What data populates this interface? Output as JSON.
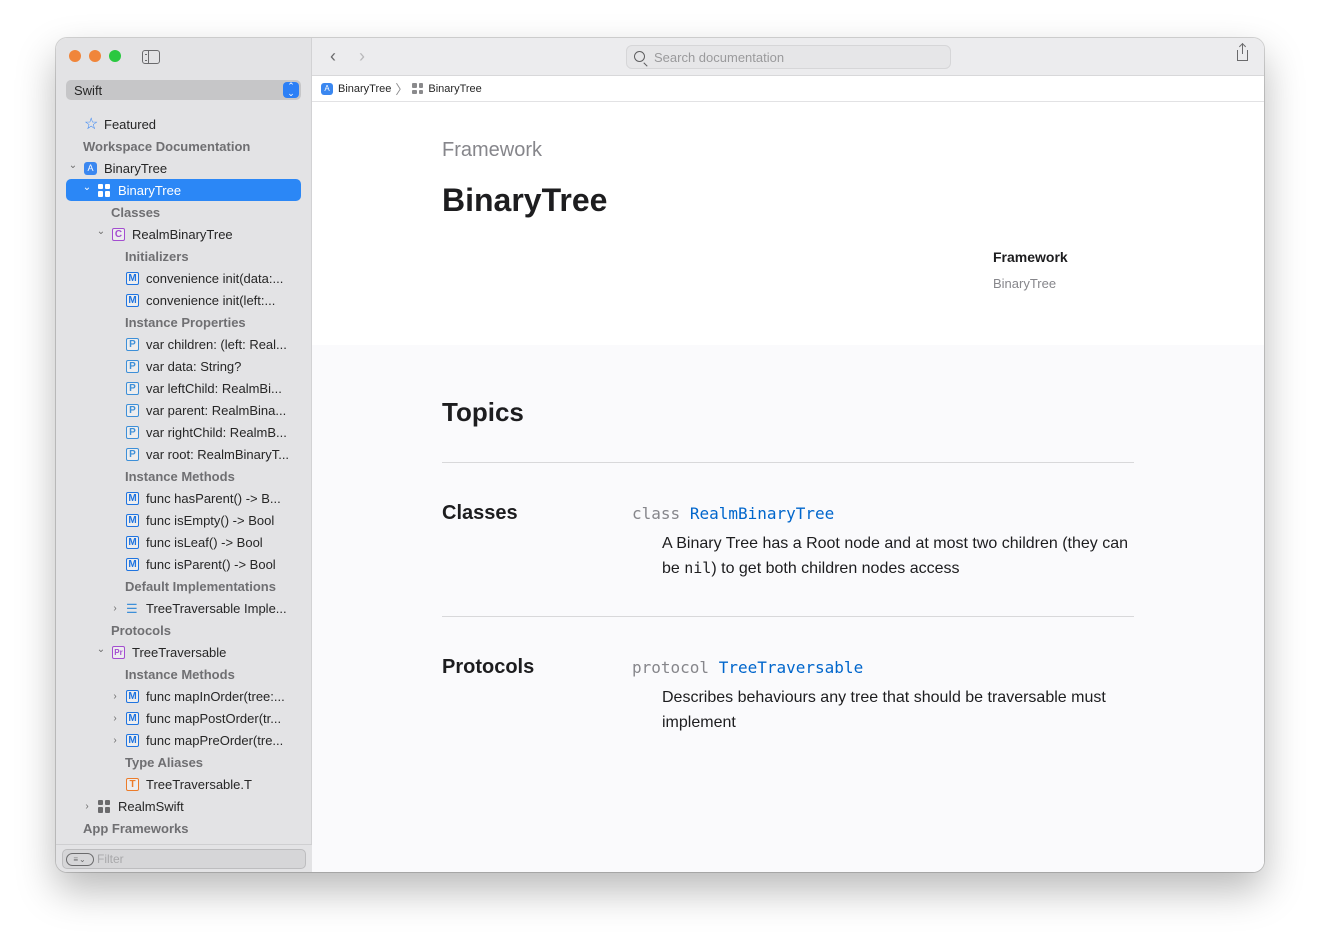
{
  "window": {
    "traffic_lights": [
      "close",
      "minimize",
      "zoom"
    ]
  },
  "sidebar": {
    "language_select": {
      "value": "Swift",
      "icon": "up-down-chevron-icon"
    },
    "tree": [
      {
        "type": "item",
        "label": "Featured",
        "icon": "star-icon",
        "level": 0
      },
      {
        "type": "header",
        "label": "Workspace Documentation",
        "level": 0
      },
      {
        "type": "item",
        "label": "BinaryTree",
        "icon": "app-icon",
        "level": 0,
        "disclosure": "expanded"
      },
      {
        "type": "item",
        "label": "BinaryTree",
        "icon": "framework-icon",
        "level": 1,
        "disclosure": "expanded",
        "selected": true
      },
      {
        "type": "header",
        "label": "Classes",
        "level": 2
      },
      {
        "type": "item",
        "label": "RealmBinaryTree",
        "icon": "class-icon",
        "glyph": "C",
        "level": 2,
        "disclosure": "expanded"
      },
      {
        "type": "header",
        "label": "Initializers",
        "level": 3
      },
      {
        "type": "item",
        "label": "convenience init(data:...",
        "icon": "method-icon",
        "glyph": "M",
        "level": 3
      },
      {
        "type": "item",
        "label": "convenience init(left:...",
        "icon": "method-icon",
        "glyph": "M",
        "level": 3
      },
      {
        "type": "header",
        "label": "Instance Properties",
        "level": 3
      },
      {
        "type": "item",
        "label": "var children: (left: Real...",
        "icon": "property-icon",
        "glyph": "P",
        "level": 3
      },
      {
        "type": "item",
        "label": "var data: String?",
        "icon": "property-icon",
        "glyph": "P",
        "level": 3
      },
      {
        "type": "item",
        "label": "var leftChild: RealmBi...",
        "icon": "property-icon",
        "glyph": "P",
        "level": 3
      },
      {
        "type": "item",
        "label": "var parent: RealmBina...",
        "icon": "property-icon",
        "glyph": "P",
        "level": 3
      },
      {
        "type": "item",
        "label": "var rightChild: RealmB...",
        "icon": "property-icon",
        "glyph": "P",
        "level": 3
      },
      {
        "type": "item",
        "label": "var root: RealmBinaryT...",
        "icon": "property-icon",
        "glyph": "P",
        "level": 3
      },
      {
        "type": "header",
        "label": "Instance Methods",
        "level": 3
      },
      {
        "type": "item",
        "label": "func hasParent() -> B...",
        "icon": "method-icon",
        "glyph": "M",
        "level": 3
      },
      {
        "type": "item",
        "label": "func isEmpty() -> Bool",
        "icon": "method-icon",
        "glyph": "M",
        "level": 3
      },
      {
        "type": "item",
        "label": "func isLeaf() -> Bool",
        "icon": "method-icon",
        "glyph": "M",
        "level": 3
      },
      {
        "type": "item",
        "label": "func isParent() -> Bool",
        "icon": "method-icon",
        "glyph": "M",
        "level": 3
      },
      {
        "type": "header",
        "label": "Default Implementations",
        "level": 3
      },
      {
        "type": "item",
        "label": "TreeTraversable Imple...",
        "icon": "list-icon",
        "level": 3,
        "disclosure": "collapsed"
      },
      {
        "type": "header",
        "label": "Protocols",
        "level": 2
      },
      {
        "type": "item",
        "label": "TreeTraversable",
        "icon": "protocol-icon",
        "glyph": "Pr",
        "level": 2,
        "disclosure": "expanded"
      },
      {
        "type": "header",
        "label": "Instance Methods",
        "level": 3
      },
      {
        "type": "item",
        "label": "func mapInOrder(tree:...",
        "icon": "method-icon",
        "glyph": "M",
        "level": 3,
        "disclosure": "collapsed"
      },
      {
        "type": "item",
        "label": "func mapPostOrder(tr...",
        "icon": "method-icon",
        "glyph": "M",
        "level": 3,
        "disclosure": "collapsed"
      },
      {
        "type": "item",
        "label": "func mapPreOrder(tre...",
        "icon": "method-icon",
        "glyph": "M",
        "level": 3,
        "disclosure": "collapsed"
      },
      {
        "type": "header",
        "label": "Type Aliases",
        "level": 3
      },
      {
        "type": "item",
        "label": "TreeTraversable.T",
        "icon": "typealias-icon",
        "glyph": "T",
        "level": 3
      },
      {
        "type": "item",
        "label": "RealmSwift",
        "icon": "framework-icon",
        "level": 1,
        "disclosure": "collapsed"
      },
      {
        "type": "header",
        "label": "App Frameworks",
        "level": 0
      }
    ],
    "filter": {
      "placeholder": "Filter",
      "icon": "filter-options-icon"
    }
  },
  "toolbar": {
    "back_icon": "chevron-left-icon",
    "forward_icon": "chevron-right-icon",
    "search": {
      "placeholder": "Search documentation",
      "value": ""
    },
    "share_icon": "share-icon"
  },
  "breadcrumb": {
    "items": [
      {
        "label": "BinaryTree",
        "icon": "app-icon"
      },
      {
        "label": "BinaryTree",
        "icon": "framework-icon"
      }
    ],
    "separator": "〉"
  },
  "page": {
    "eyebrow": "Framework",
    "title": "BinaryTree",
    "meta": {
      "label": "Framework",
      "value": "BinaryTree"
    },
    "topics": {
      "title": "Topics",
      "sections": [
        {
          "heading": "Classes",
          "keyword": "class",
          "name": "RealmBinaryTree",
          "abstract_before": "A Binary Tree has a Root node and at most two children (they can be ",
          "abstract_code": "nil",
          "abstract_after": ") to get both children nodes access"
        },
        {
          "heading": "Protocols",
          "keyword": "protocol",
          "name": "TreeTraversable",
          "abstract_before": "Describes behaviours any tree that should be traversable must implement",
          "abstract_code": "",
          "abstract_after": ""
        }
      ]
    }
  },
  "colors": {
    "accent": "#2b87f6",
    "link": "#0066cc",
    "method": "#1f74e0",
    "class_protocol": "#a34dd0",
    "typealias": "#ec7c2a"
  }
}
